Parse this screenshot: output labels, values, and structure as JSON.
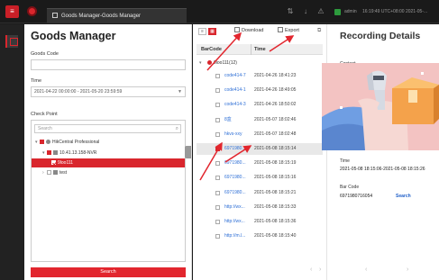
{
  "window": {
    "tab_title": "Goods Manager-Goods Manager",
    "user": "admin",
    "datetime": "16:19:49 UTC+08:00 2021-05-..."
  },
  "icons": {
    "menu": "menu-icon",
    "logo": "app-logo-icon",
    "rail_goods": "goods-manager-icon"
  },
  "colors": {
    "accent": "#d9262d",
    "link": "#2e6fd6",
    "annotation_arrow": "#e2262e"
  },
  "left": {
    "title": "Goods Manager",
    "goods_code_label": "Goods Code",
    "goods_code_value": "",
    "time_label": "Time",
    "time_value": "2021-04-22 00:00:00 - 2021-05-20 23:59:59",
    "checkpoint_label": "Check Point",
    "search_placeholder": "Search",
    "tree": [
      {
        "label": "HikCentral Professional",
        "level": 1,
        "state": "partial",
        "expanded": true
      },
      {
        "label": "10.41.13.158-NVR",
        "level": 2,
        "state": "checked",
        "expanded": true
      },
      {
        "label": "9loo111",
        "level": 3,
        "state": "checked",
        "selected": true
      },
      {
        "label": "test",
        "level": 2,
        "state": "unchecked",
        "expanded": false
      }
    ],
    "search_button": "Search"
  },
  "middle": {
    "download_label": "Download",
    "export_label": "Export",
    "columns": [
      "BarCode",
      "Time"
    ],
    "group_label": "9loo111(12)",
    "rows": [
      {
        "code": "code414-7",
        "time": "2021-04-26 18:41:23",
        "selected": false
      },
      {
        "code": "code414-1",
        "time": "2021-04-26 18:49:05",
        "selected": false
      },
      {
        "code": "code414-3",
        "time": "2021-04-26 18:50:02",
        "selected": false
      },
      {
        "code": "8盒",
        "time": "2021-05-07 18:02:46",
        "selected": false
      },
      {
        "code": "hkvs-xxy",
        "time": "2021-05-07 18:02:48",
        "selected": false
      },
      {
        "code": "6971980...",
        "time": "2021-05-08 18:15:14",
        "selected": true
      },
      {
        "code": "6971980...",
        "time": "2021-05-08 18:15:19",
        "selected": false
      },
      {
        "code": "6971980...",
        "time": "2021-05-08 18:15:16",
        "selected": false
      },
      {
        "code": "6971980...",
        "time": "2021-05-08 18:15:21",
        "selected": false
      },
      {
        "code": "http://wx...",
        "time": "2021-05-08 18:15:33",
        "selected": false
      },
      {
        "code": "http://wx...",
        "time": "2021-05-08 18:15:36",
        "selected": false
      },
      {
        "code": "http://m.l...",
        "time": "2021-05-08 18:15:40",
        "selected": false
      }
    ]
  },
  "right": {
    "title": "Recording Details",
    "content_label": "Content",
    "time_label": "Time",
    "time_value": "2021-05-08 18:15:06-2021-05-08 18:15:26",
    "barcode_label": "Bar Code",
    "barcode_value": "6971980716054",
    "search_link": "Search"
  }
}
